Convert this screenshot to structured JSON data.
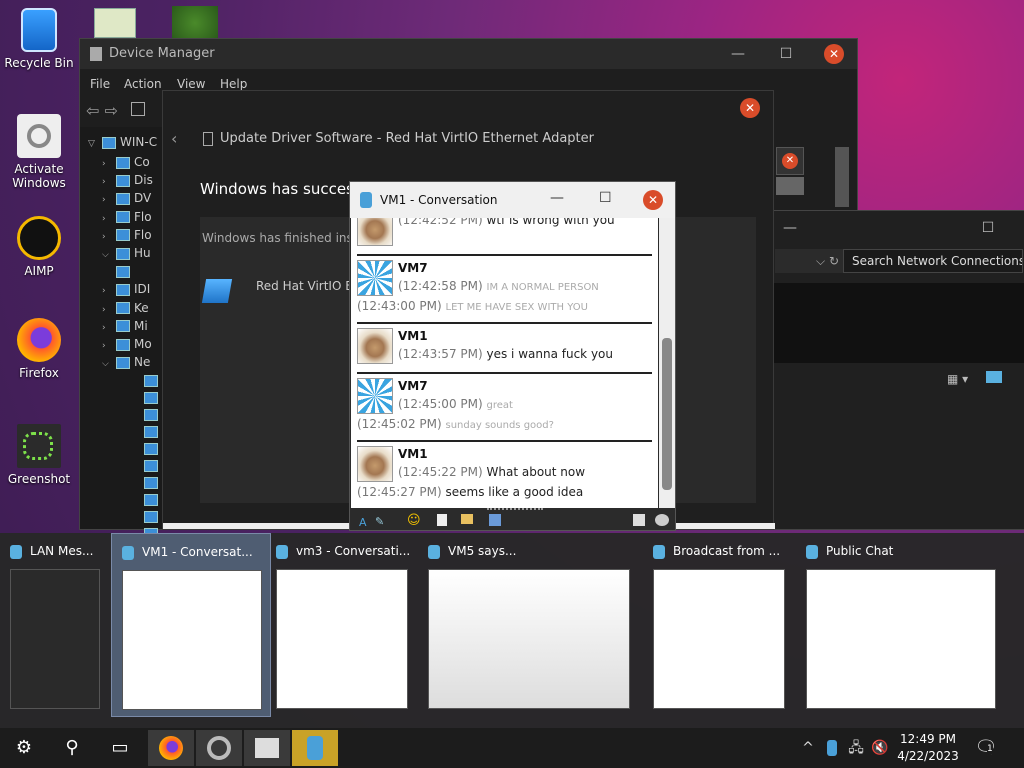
{
  "desktop": {
    "icons": [
      {
        "label": "Recycle Bin"
      },
      {
        "label": "Activate Windows"
      },
      {
        "label": "AIMP"
      },
      {
        "label": "Firefox"
      },
      {
        "label": "Greenshot"
      }
    ]
  },
  "device_manager": {
    "title": "Device Manager",
    "menu": [
      "File",
      "Action",
      "View",
      "Help"
    ],
    "root": "WIN-C",
    "tree": [
      "Co",
      "Dis",
      "DV",
      "Flo",
      "Flo",
      "Hu",
      "",
      "IDI",
      "Ke",
      "Mi",
      "Mo",
      "Ne"
    ]
  },
  "update_driver": {
    "header": "Update Driver Software - Red Hat VirtIO Ethernet Adapter",
    "headline": "Windows has success",
    "body": "Windows has finished insta",
    "device": "Red Hat VirtIO E"
  },
  "network": {
    "search_placeholder": "Search Network Connections"
  },
  "conversation": {
    "title": "VM1 - Conversation",
    "messages": [
      {
        "sender": "",
        "avatar": "cat",
        "lines": [
          {
            "ts": "(12:42:52 PM)",
            "text": "wtf is wrong with you",
            "grey": false
          }
        ]
      },
      {
        "sender": "VM7",
        "avatar": "wind",
        "lines": [
          {
            "ts": "(12:42:58 PM)",
            "text": "IM A NORMAL PERSON",
            "grey": true
          },
          {
            "ts": "(12:43:00 PM)",
            "text": "LET ME HAVE SEX WITH YOU",
            "grey": true
          }
        ]
      },
      {
        "sender": "VM1",
        "avatar": "cat",
        "lines": [
          {
            "ts": "(12:43:57 PM)",
            "text": "yes i wanna fuck you",
            "grey": false
          }
        ]
      },
      {
        "sender": "VM7",
        "avatar": "wind",
        "lines": [
          {
            "ts": "(12:45:00 PM)",
            "text": "great",
            "grey": true
          },
          {
            "ts": "(12:45:02 PM)",
            "text": "sunday sounds good?",
            "grey": true
          }
        ]
      },
      {
        "sender": "VM1",
        "avatar": "cat",
        "lines": [
          {
            "ts": "(12:45:22 PM)",
            "text": "What about now",
            "grey": false
          },
          {
            "ts": "(12:45:27 PM)",
            "text": "seems like a good idea",
            "grey": false
          }
        ]
      }
    ]
  },
  "task_switcher": [
    {
      "title": "LAN Mes..."
    },
    {
      "title": "VM1 - Conversat..."
    },
    {
      "title": "vm3 - Conversati..."
    },
    {
      "title": "VM5 says..."
    },
    {
      "title": "Broadcast from ..."
    },
    {
      "title": "Public Chat"
    }
  ],
  "taskbar": {
    "time": "12:49 PM",
    "date": "4/22/2023",
    "notification_count": "1"
  }
}
